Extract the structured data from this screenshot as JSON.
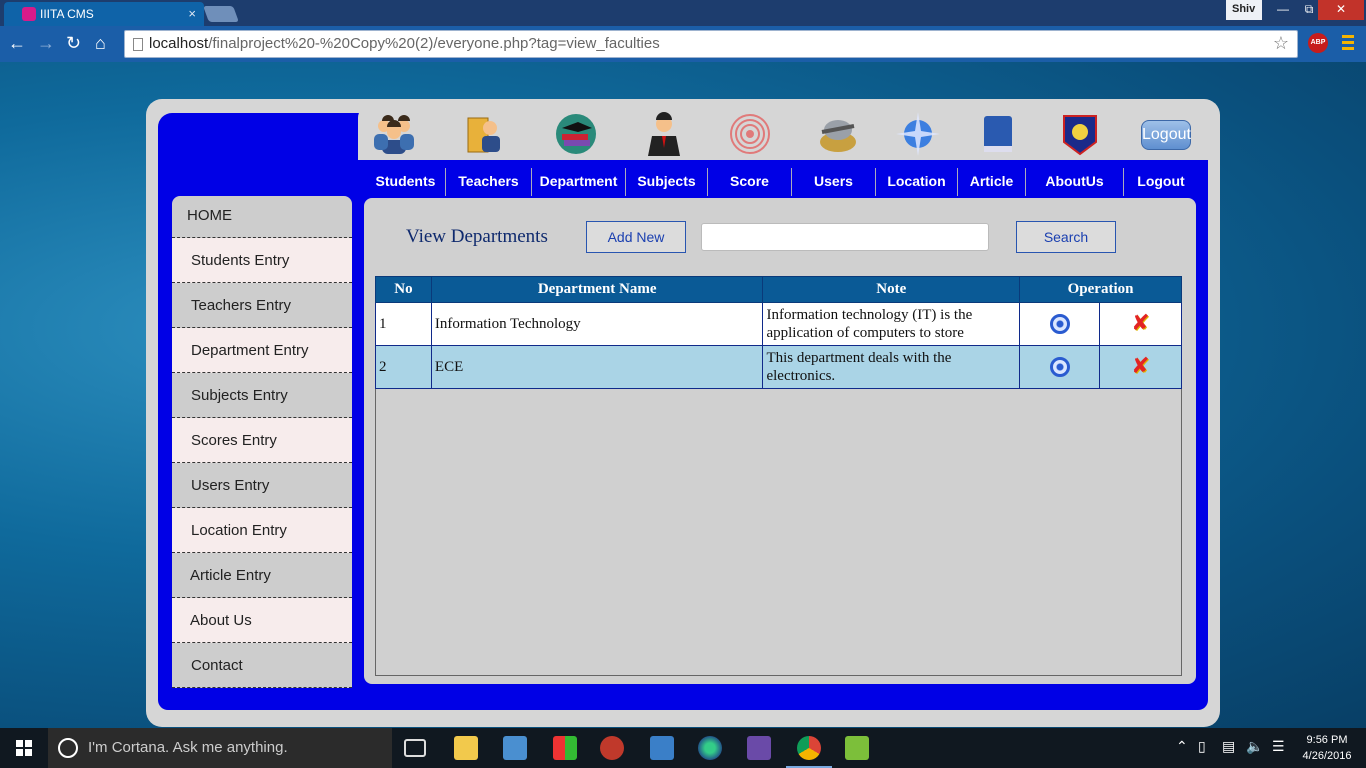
{
  "browser": {
    "tab_title": "IIITA CMS",
    "tab_close": "×",
    "profile_name": "Shiv",
    "url_host": "localhost",
    "url_path": "/finalproject%20-%20Copy%20(2)/everyone.php?tag=view_faculties",
    "abp_label": "ABP"
  },
  "header": {
    "icons": [
      "students-icon",
      "teachers-icon",
      "department-icon",
      "subjects-icon",
      "score-icon",
      "users-icon",
      "location-icon",
      "article-icon",
      "aboutus-icon"
    ],
    "logout_button": "Logout"
  },
  "nav": {
    "items": [
      {
        "label": "Students"
      },
      {
        "label": "Teachers"
      },
      {
        "label": "Department"
      },
      {
        "label": "Subjects"
      },
      {
        "label": "Score"
      },
      {
        "label": "Users"
      },
      {
        "label": "Location"
      },
      {
        "label": "Article"
      },
      {
        "label": "AboutUs"
      },
      {
        "label": "Logout"
      }
    ]
  },
  "sidebar": {
    "items": [
      {
        "label": "HOME"
      },
      {
        "label": "Students Entry"
      },
      {
        "label": "Teachers Entry"
      },
      {
        "label": "Department Entry"
      },
      {
        "label": "Subjects Entry"
      },
      {
        "label": "Scores Entry"
      },
      {
        "label": "Users Entry"
      },
      {
        "label": "Location Entry"
      },
      {
        "label": "Article Entry"
      },
      {
        "label": "About Us"
      },
      {
        "label": "Contact"
      }
    ]
  },
  "main": {
    "title": "View Departments",
    "add_new": "Add New",
    "search_value": "",
    "search_button": "Search",
    "table": {
      "headers": [
        "No",
        "Department Name",
        "Note",
        "Operation"
      ],
      "rows": [
        {
          "no": "1",
          "name": "Information Technology",
          "note": "Information technology (IT) is the application of computers to store"
        },
        {
          "no": "2",
          "name": "ECE",
          "note": "This department deals with the electronics."
        }
      ]
    }
  },
  "taskbar": {
    "cortana_text": "I'm Cortana. Ask me anything.",
    "time": "9:56 PM",
    "date": "4/26/2016"
  },
  "colors": {
    "frame_blue": "#0000e6",
    "table_header": "#0a5a96",
    "row_alt": "#aad4e6"
  }
}
